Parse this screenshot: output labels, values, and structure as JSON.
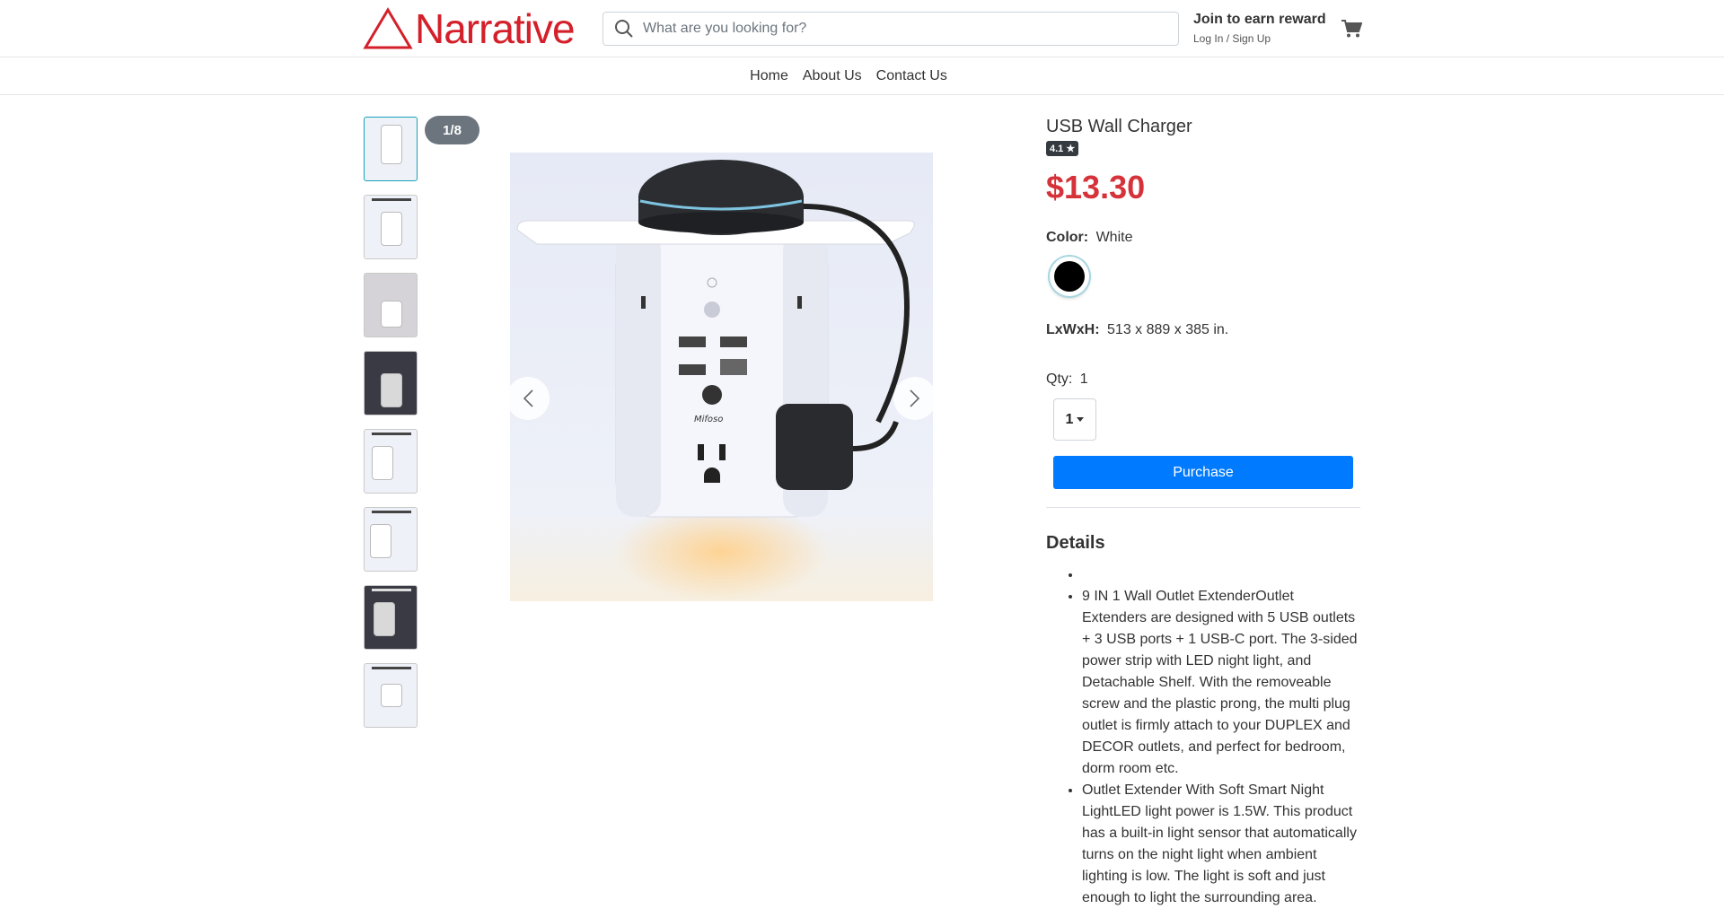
{
  "header": {
    "logo_text": "Narrative",
    "search_placeholder": "What are you looking for?",
    "join_label": "Join to earn reward",
    "login_label": "Log In / Sign Up"
  },
  "nav": {
    "items": [
      "Home",
      "About Us",
      "Contact Us"
    ]
  },
  "gallery": {
    "counter": "1/8",
    "thumbnail_count": 8,
    "active_index": 0
  },
  "product": {
    "title": "USB Wall Charger",
    "rating": "4.1 ★",
    "price": "$13.30",
    "color_label": "Color:",
    "color_value": "White",
    "dims_label": "LxWxH:",
    "dims_value": "513 x 889 x 385 in.",
    "qty_label": "Qty:",
    "qty_value": "1",
    "qty_selected": "1",
    "purchase_label": "Purchase",
    "details_heading": "Details",
    "details": [
      "",
      "9 IN 1 Wall Outlet ExtenderOutlet Extenders are designed with 5 USB outlets + 3 USB ports + 1 USB-C port. The 3-sided power strip with LED night light, and Detachable Shelf. With the removeable screw and the plastic prong, the multi plug outlet is firmly attach to your DUPLEX and DECOR outlets, and perfect for bedroom, dorm room etc.",
      "Outlet Extender With Soft Smart Night LightLED light power is 1.5W. This product has a built-in light sensor that automatically turns on the night light when ambient lighting is low. The light is soft and just enough to light the surrounding area."
    ]
  },
  "colors": {
    "brand_red": "#d4202a",
    "price_red": "#d6323a",
    "button_blue": "#007bff",
    "swatch": "#000000"
  }
}
